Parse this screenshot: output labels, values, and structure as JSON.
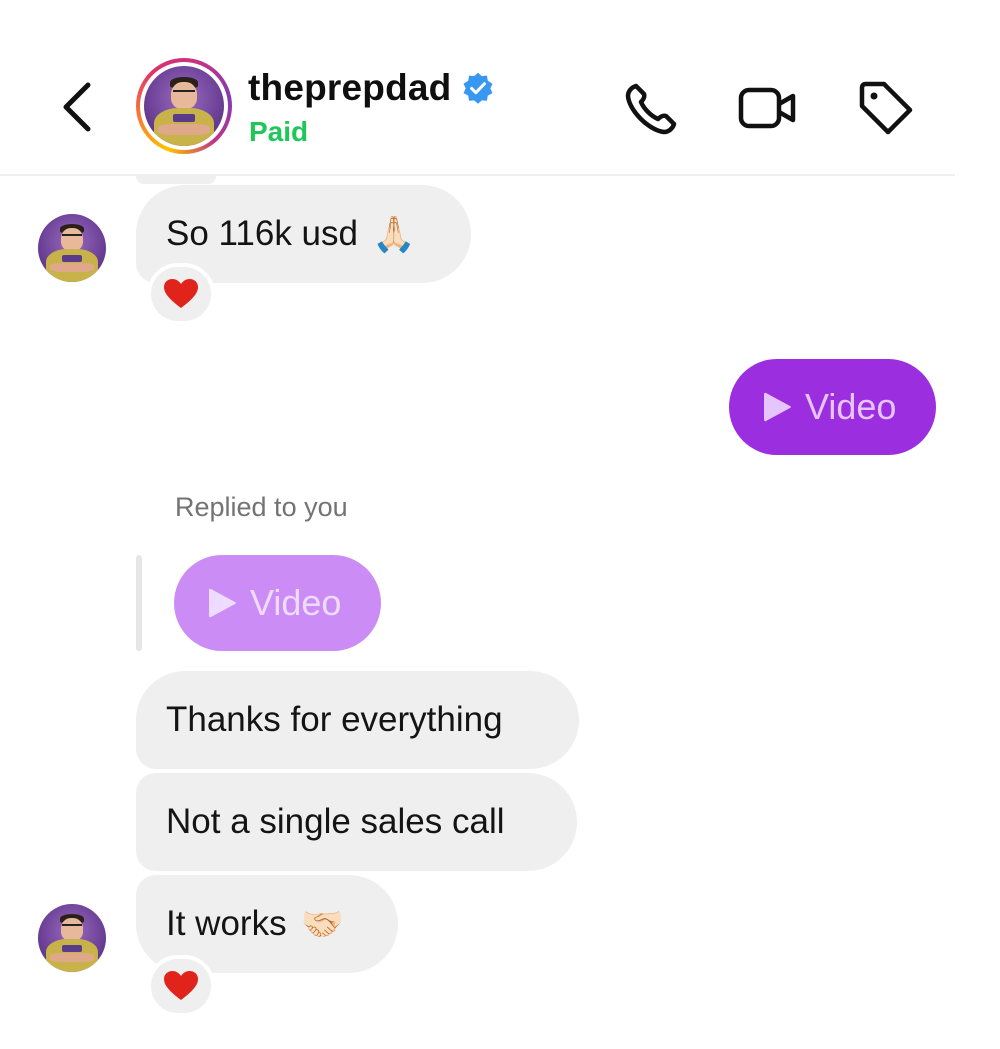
{
  "header": {
    "username": "theprepdad",
    "status": "Paid",
    "verified": true,
    "status_color": "#1fc65a",
    "icons": [
      "back-icon",
      "phone-icon",
      "video-camera-icon",
      "tag-icon"
    ]
  },
  "messages": [
    {
      "text": "So 116k usd",
      "emoji": "🙏🏻",
      "reaction": "heart",
      "from": "them"
    },
    {
      "video_label": "Video",
      "from": "me"
    },
    {
      "replied_label": "Replied to you",
      "reply_video_label": "Video"
    },
    {
      "text": "Thanks for everything",
      "from": "them"
    },
    {
      "text": "Not a single sales call",
      "from": "them"
    },
    {
      "text": "It works",
      "emoji": "🤝🏻",
      "reaction": "heart",
      "from": "them"
    }
  ],
  "colors": {
    "sent_video_bg": "#9b2fe0",
    "reply_video_bg": "#cc8cf5",
    "received_bubble_bg": "#efefef",
    "verified_blue": "#3897f0",
    "heart_red": "#e0241b"
  }
}
